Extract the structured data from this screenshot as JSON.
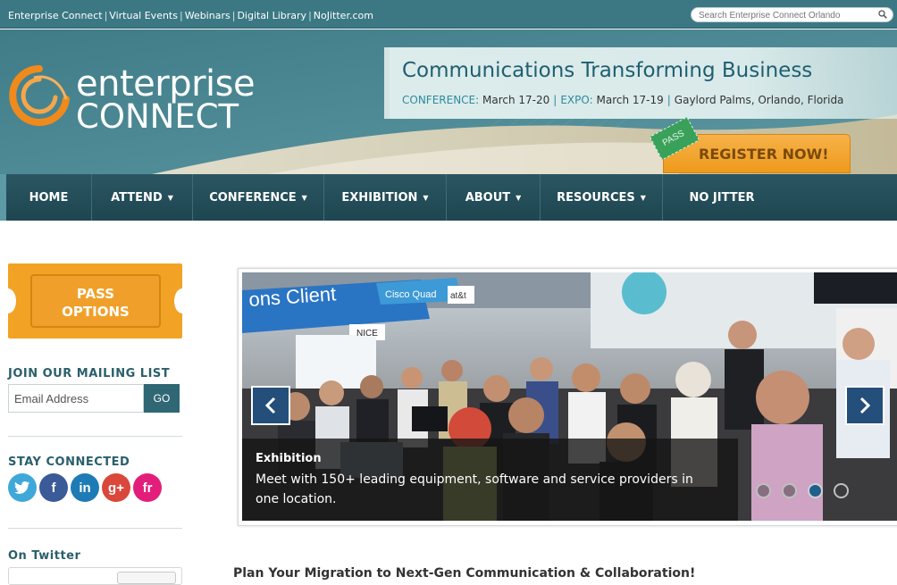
{
  "topbar": {
    "links": [
      "Enterprise Connect",
      "Virtual Events",
      "Webinars",
      "Digital Library",
      "NoJitter.com"
    ],
    "search_placeholder": "Search Enterprise Connect Orlando"
  },
  "logo": {
    "word1": "enterprise",
    "word2": "CONNECT"
  },
  "banner": {
    "title": "Communications Transforming Business",
    "conference_key": "CONFERENCE:",
    "conference_dates": "March 17-20",
    "expo_key": "EXPO:",
    "expo_dates": "March 17-19",
    "venue": "Gaylord Palms, Orlando, Florida",
    "pass_tag": "PASS",
    "register_label": "REGISTER NOW!"
  },
  "nav": {
    "items": [
      {
        "label": "HOME",
        "has_menu": false
      },
      {
        "label": "ATTEND",
        "has_menu": true
      },
      {
        "label": "CONFERENCE",
        "has_menu": true
      },
      {
        "label": "EXHIBITION",
        "has_menu": true
      },
      {
        "label": "ABOUT",
        "has_menu": true
      },
      {
        "label": "RESOURCES",
        "has_menu": true
      },
      {
        "label": "NO JITTER",
        "has_menu": false
      }
    ]
  },
  "sidebar": {
    "pass_options_line1": "PASS",
    "pass_options_line2": "OPTIONS",
    "mailing_heading": "JOIN OUR MAILING LIST",
    "email_placeholder": "Email Address",
    "go_label": "GO",
    "stay_connected_heading": "STAY CONNECTED",
    "social": [
      {
        "name": "twitter",
        "glyph": "t",
        "color": "#3fa8d8"
      },
      {
        "name": "facebook",
        "glyph": "f",
        "color": "#3a5a98"
      },
      {
        "name": "linkedin",
        "glyph": "in",
        "color": "#1f7bb5"
      },
      {
        "name": "googleplus",
        "glyph": "g+",
        "color": "#d9483b"
      },
      {
        "name": "friendfeed",
        "glyph": "fr",
        "color": "#e21e7a"
      }
    ],
    "twitter_heading": "On Twitter"
  },
  "slider": {
    "caption_title": "Exhibition",
    "caption_text": "Meet with 150+ leading equipment, software and service providers in one location.",
    "booth_sign_1": "ons Client",
    "booth_sign_2": "Cisco Quad",
    "booth_sign_3": "NICE",
    "booth_sign_4": "at&t",
    "slide_count": 4,
    "active_slide": 3
  },
  "main": {
    "heading": "Plan Your Migration to Next-Gen Communication & Collaboration!"
  },
  "colors": {
    "topbar": "#3b7884",
    "header": "#4d8994",
    "nav": "#1e4651",
    "accent_orange": "#f2a224",
    "heading_teal": "#2a5f6b"
  }
}
